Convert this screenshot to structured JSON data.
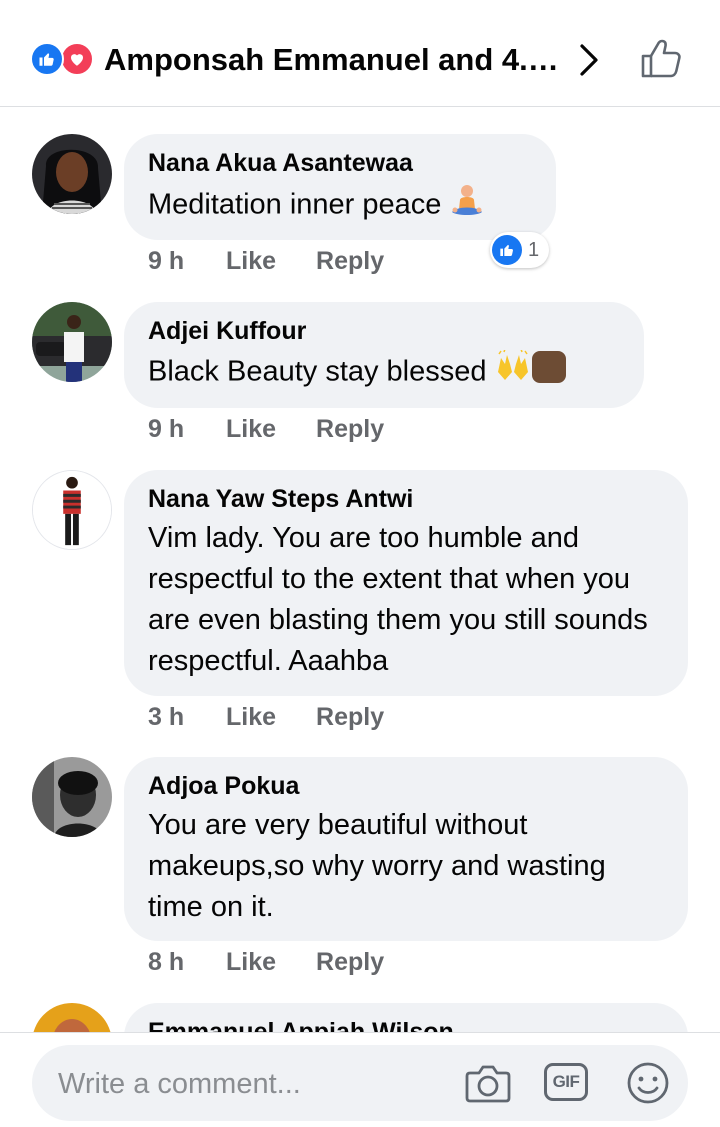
{
  "header": {
    "title": "Amponsah Emmanuel and 4.2...",
    "reaction_icons": [
      "like-reaction-icon",
      "love-reaction-icon"
    ],
    "accent_like": "#1877f2",
    "accent_love": "#f33e58"
  },
  "comments": [
    {
      "author": "Nana Akua Asantewaa",
      "text": "Meditation inner peace",
      "emoji": "person-in-lotus-position",
      "time": "9 h",
      "like": "Like",
      "reply": "Reply",
      "reactions": {
        "type": "like",
        "count": "1"
      }
    },
    {
      "author": "Adjei Kuffour",
      "text": "Black Beauty stay blessed",
      "emoji": "raising-hands-dark-skin-tone",
      "time": "9 h",
      "like": "Like",
      "reply": "Reply"
    },
    {
      "author": "Nana Yaw Steps Antwi",
      "text": "Vim lady. You are too humble and respectful to the extent that when you are even blasting them you  still sounds respectful. Aaahba",
      "time": "3 h",
      "like": "Like",
      "reply": "Reply"
    },
    {
      "author": "Adjoa Pokua",
      "text": "You are very beautiful without makeups,so why worry and wasting time on it.",
      "time": "8 h",
      "like": "Like",
      "reply": "Reply"
    },
    {
      "author": "Emmanuel Appiah Wilson"
    }
  ],
  "composer": {
    "placeholder": "Write a comment...",
    "gif_label": "GIF",
    "icons": [
      "camera-icon",
      "gif-icon",
      "emoji-icon"
    ]
  },
  "colors": {
    "bubble": "#f0f2f5",
    "meta_text": "#65676b",
    "divider": "#dddfe2"
  }
}
